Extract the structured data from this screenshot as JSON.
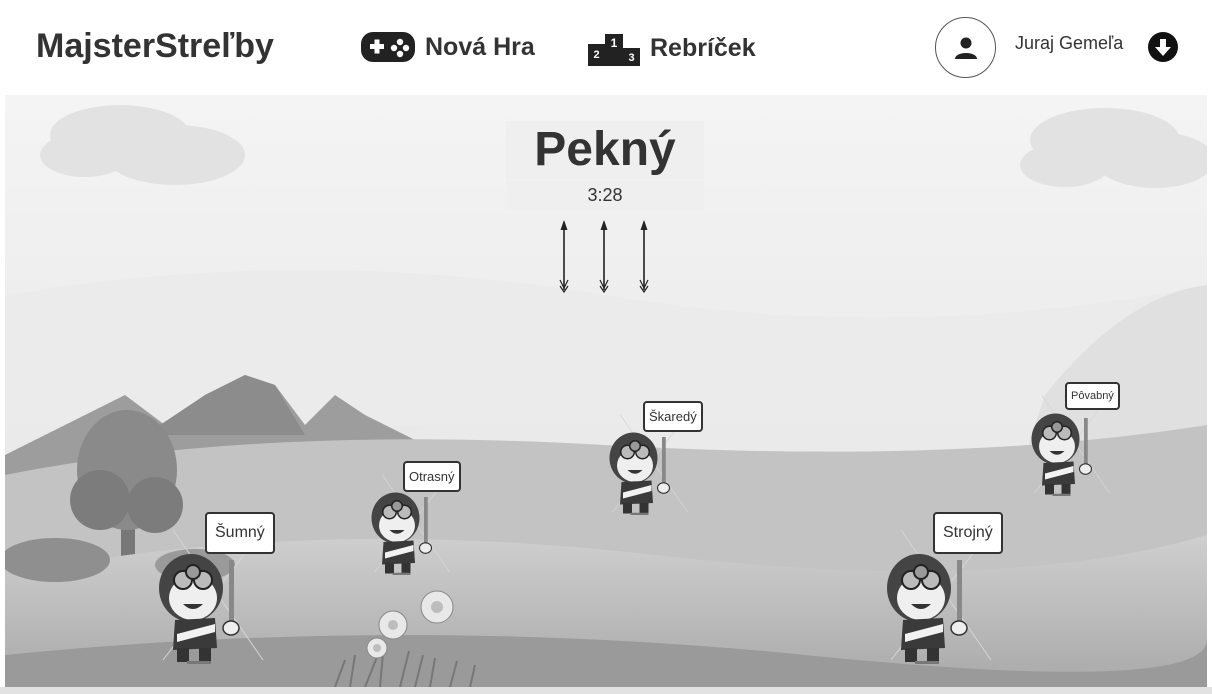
{
  "header": {
    "brand": "MajsterStreľby",
    "nav": {
      "new_game": "Nová Hra",
      "leaderboard": "Rebríček"
    },
    "user": {
      "name": "Juraj Gemeľa"
    }
  },
  "game": {
    "prompt_word": "Pekný",
    "timer": "3:28",
    "arrows_remaining": 3,
    "targets": [
      {
        "label": "Šumný"
      },
      {
        "label": "Otrasný"
      },
      {
        "label": "Škaredý"
      },
      {
        "label": "Pôvabný"
      },
      {
        "label": "Strojný"
      }
    ]
  },
  "icons": {
    "new_game": "gamepad-icon",
    "leaderboard": "podium-icon",
    "avatar": "user-icon",
    "menu": "arrow-down-circle-icon"
  },
  "colors": {
    "text": "#333333",
    "panel": "#efefef",
    "sky": "#f2f2f2",
    "hill": "#b9b9b9"
  }
}
